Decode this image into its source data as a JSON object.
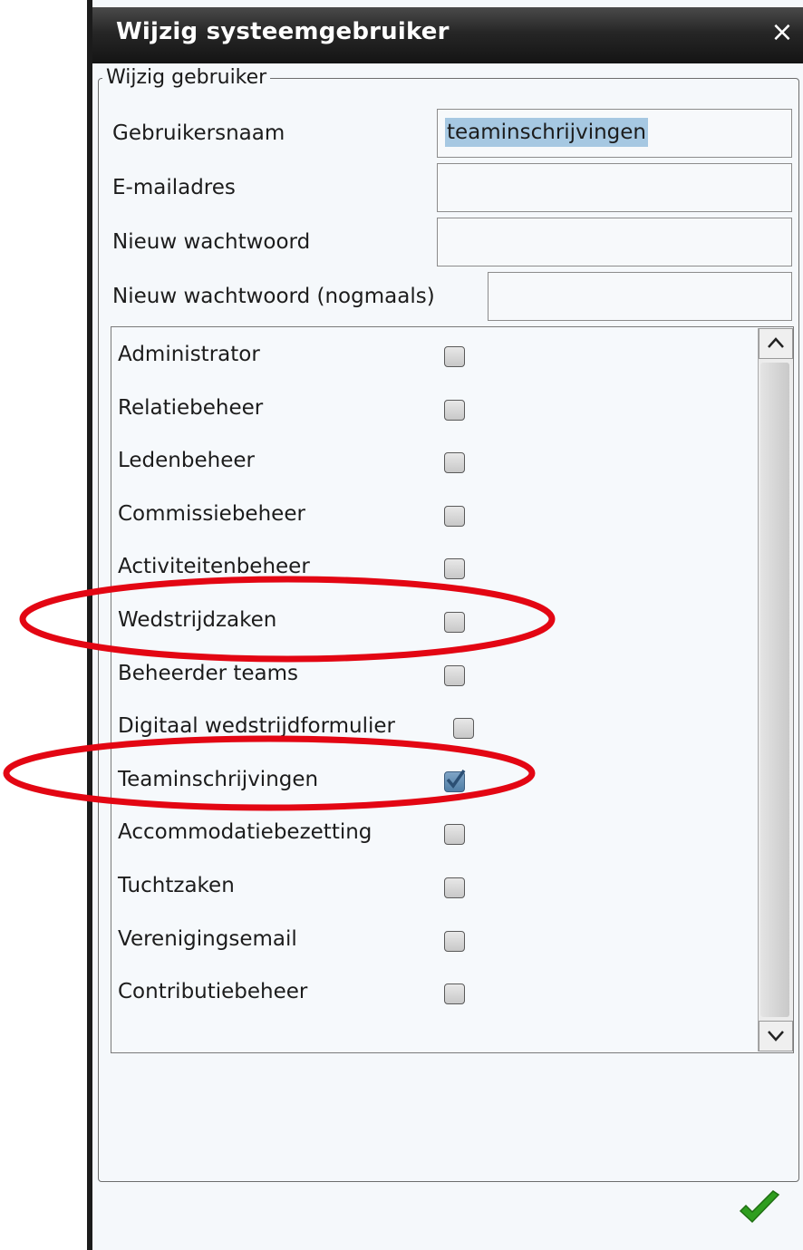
{
  "dialog": {
    "title": "Wijzig systeemgebruiker",
    "close_icon": "×",
    "fieldset_legend": "Wijzig gebruiker"
  },
  "fields": {
    "username_label": "Gebruikersnaam",
    "username_value": "teaminschrijvingen",
    "email_label": "E-mailadres",
    "email_value": "",
    "password_label": "Nieuw wachtwoord",
    "password_value": "",
    "password_repeat_label": "Nieuw wachtwoord (nogmaals)",
    "password_repeat_value": ""
  },
  "roles": [
    {
      "label": "Administrator",
      "checked": false
    },
    {
      "label": "Relatiebeheer",
      "checked": false
    },
    {
      "label": "Ledenbeheer",
      "checked": false
    },
    {
      "label": "Commissiebeheer",
      "checked": false
    },
    {
      "label": "Activiteitenbeheer",
      "checked": false
    },
    {
      "label": "Wedstrijdzaken",
      "checked": false,
      "highlighted": true
    },
    {
      "label": "Beheerder teams",
      "checked": false
    },
    {
      "label": "Digitaal wedstrijdformulier",
      "checked": false
    },
    {
      "label": "Teaminschrijvingen",
      "checked": true,
      "highlighted": true
    },
    {
      "label": "Accommodatiebezetting",
      "checked": false
    },
    {
      "label": "Tuchtzaken",
      "checked": false
    },
    {
      "label": "Verenigingsemail",
      "checked": false
    },
    {
      "label": "Contributiebeheer",
      "checked": false
    }
  ],
  "icons": {
    "scroll_up": "chevron-up-icon",
    "scroll_down": "chevron-down-icon",
    "confirm": "checkmark-icon",
    "close": "close-icon"
  },
  "colors": {
    "titlebar": "#1f1f1f",
    "highlight_oval": "#e30613",
    "confirm_check": "#2f9e1f",
    "selection": "#a6c8e2"
  }
}
